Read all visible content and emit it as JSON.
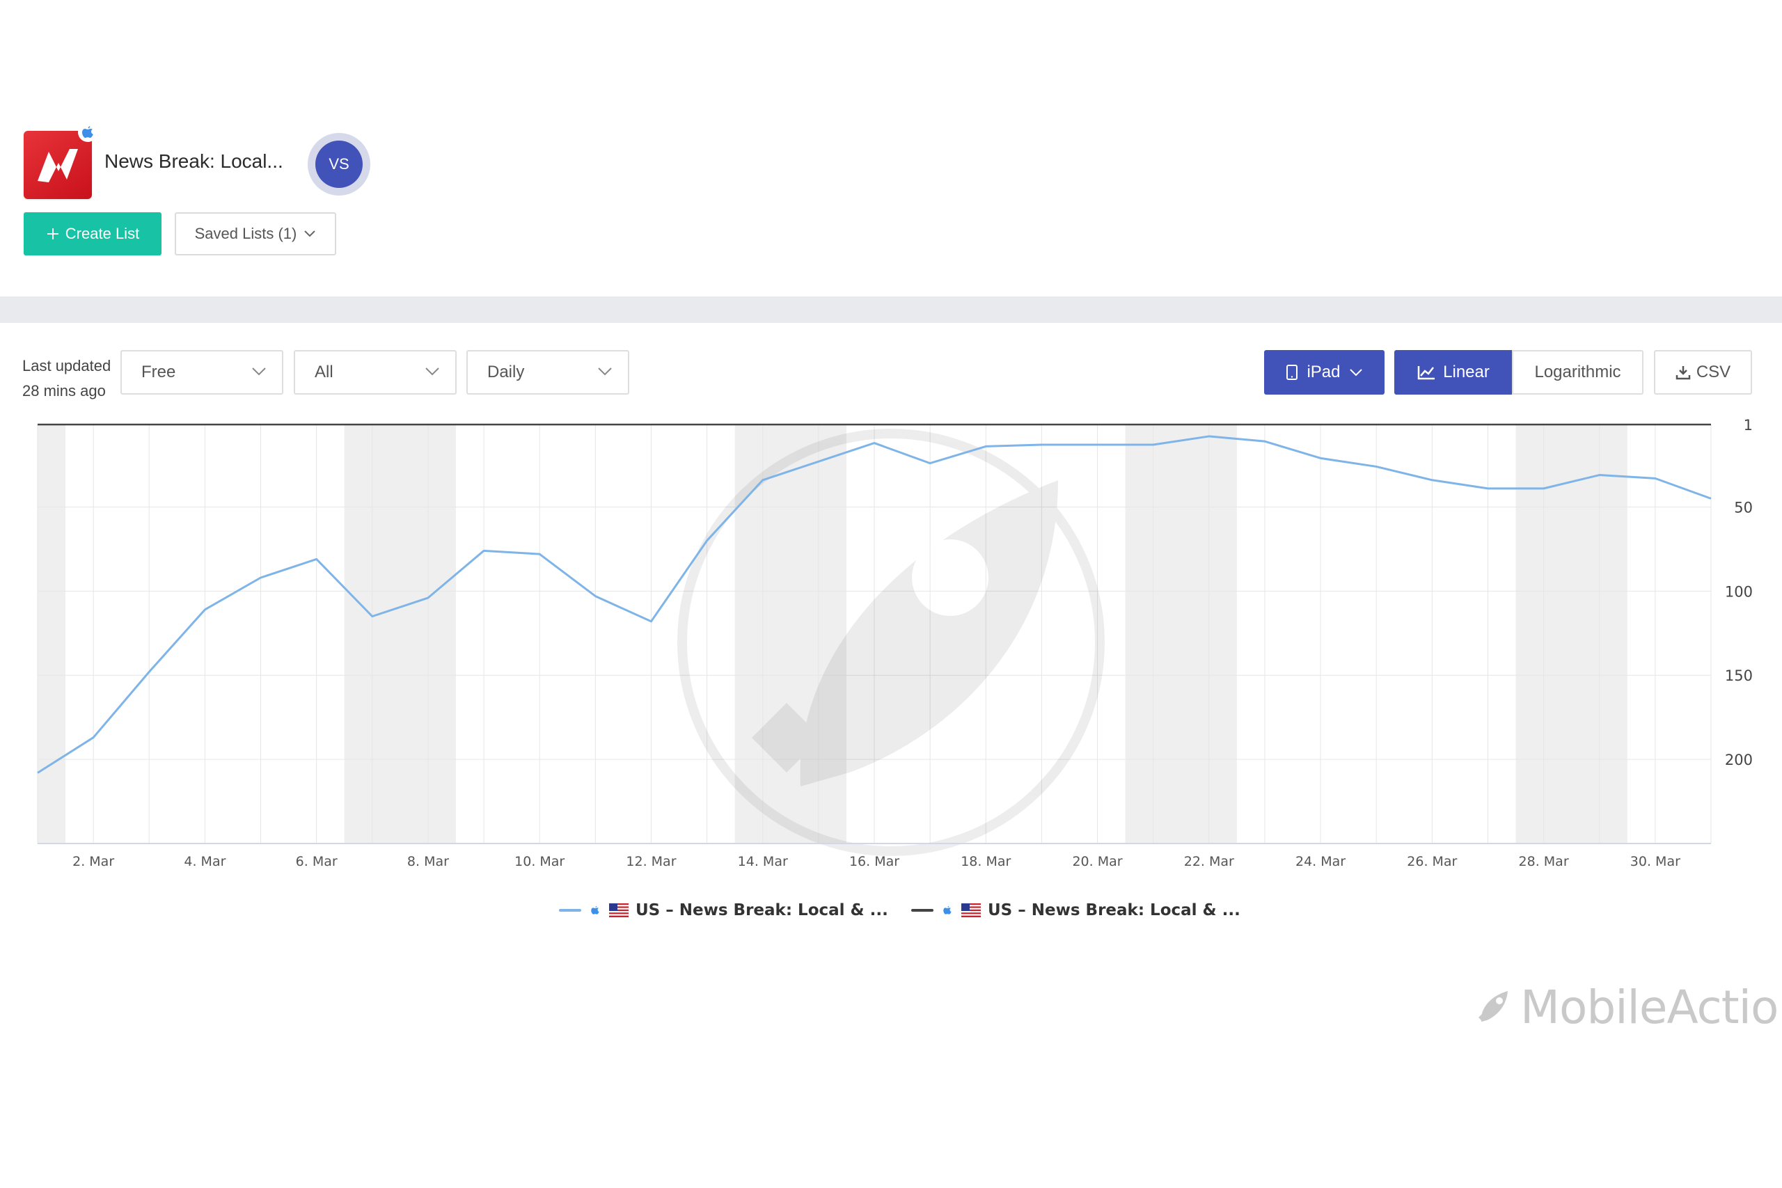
{
  "header": {
    "app_title": "News Break: Local...",
    "vs_label": "VS",
    "create_list_label": "Create List",
    "saved_lists_label": "Saved Lists (1)"
  },
  "filters": {
    "last_updated_line1": "Last updated",
    "last_updated_line2": "28 mins ago",
    "price_filter": "Free",
    "category_filter": "All",
    "interval_filter": "Daily",
    "device_label": "iPad",
    "linear_label": "Linear",
    "log_label": "Logarithmic",
    "csv_label": "CSV"
  },
  "colors": {
    "series1": "#7fb4e8",
    "series2": "#444444",
    "accent": "#4152b8",
    "create_button": "#17c3a4"
  },
  "brand": {
    "name": "MobileAction"
  },
  "chart_data": {
    "type": "line",
    "x": [
      "1. Mar",
      "2. Mar",
      "3. Mar",
      "4. Mar",
      "5. Mar",
      "6. Mar",
      "7. Mar",
      "8. Mar",
      "9. Mar",
      "10. Mar",
      "11. Mar",
      "12. Mar",
      "13. Mar",
      "14. Mar",
      "15. Mar",
      "16. Mar",
      "17. Mar",
      "18. Mar",
      "19. Mar",
      "20. Mar",
      "21. Mar",
      "22. Mar",
      "23. Mar",
      "24. Mar",
      "25. Mar",
      "26. Mar",
      "27. Mar",
      "28. Mar",
      "29. Mar",
      "30. Mar",
      "31. Mar"
    ],
    "x_tick_labels": [
      "2. Mar",
      "4. Mar",
      "6. Mar",
      "8. Mar",
      "10. Mar",
      "12. Mar",
      "14. Mar",
      "16. Mar",
      "18. Mar",
      "20. Mar",
      "22. Mar",
      "24. Mar",
      "26. Mar",
      "28. Mar",
      "30. Mar"
    ],
    "series": [
      {
        "name": "US – News Break: Local & ...",
        "values": [
          208,
          187,
          148,
          111,
          92,
          81,
          115,
          104,
          76,
          78,
          103,
          118,
          70,
          34,
          23,
          12,
          24,
          14,
          13,
          13,
          13,
          8,
          11,
          21,
          26,
          34,
          39,
          39,
          31,
          33,
          45
        ]
      },
      {
        "name": "US – News Break: Local & ...",
        "values": [
          1,
          1,
          1,
          1,
          1,
          1,
          1,
          1,
          1,
          1,
          1,
          1,
          1,
          1,
          1,
          1,
          1,
          1,
          1,
          1,
          1,
          1,
          1,
          1,
          1,
          1,
          1,
          1,
          1,
          1,
          1
        ]
      }
    ],
    "y_axis": {
      "reversed": true,
      "ylim": [
        1,
        250
      ],
      "tick_labels": [
        "1",
        "50",
        "100",
        "150",
        "200"
      ]
    },
    "weekend_bands": [
      [
        "1. Mar",
        "1. Mar"
      ],
      [
        "7. Mar",
        "8. Mar"
      ],
      [
        "14. Mar",
        "15. Mar"
      ],
      [
        "21. Mar",
        "22. Mar"
      ],
      [
        "28. Mar",
        "29. Mar"
      ]
    ],
    "grid": true,
    "legend_position": "bottom-center",
    "y_axis_position": "right"
  }
}
